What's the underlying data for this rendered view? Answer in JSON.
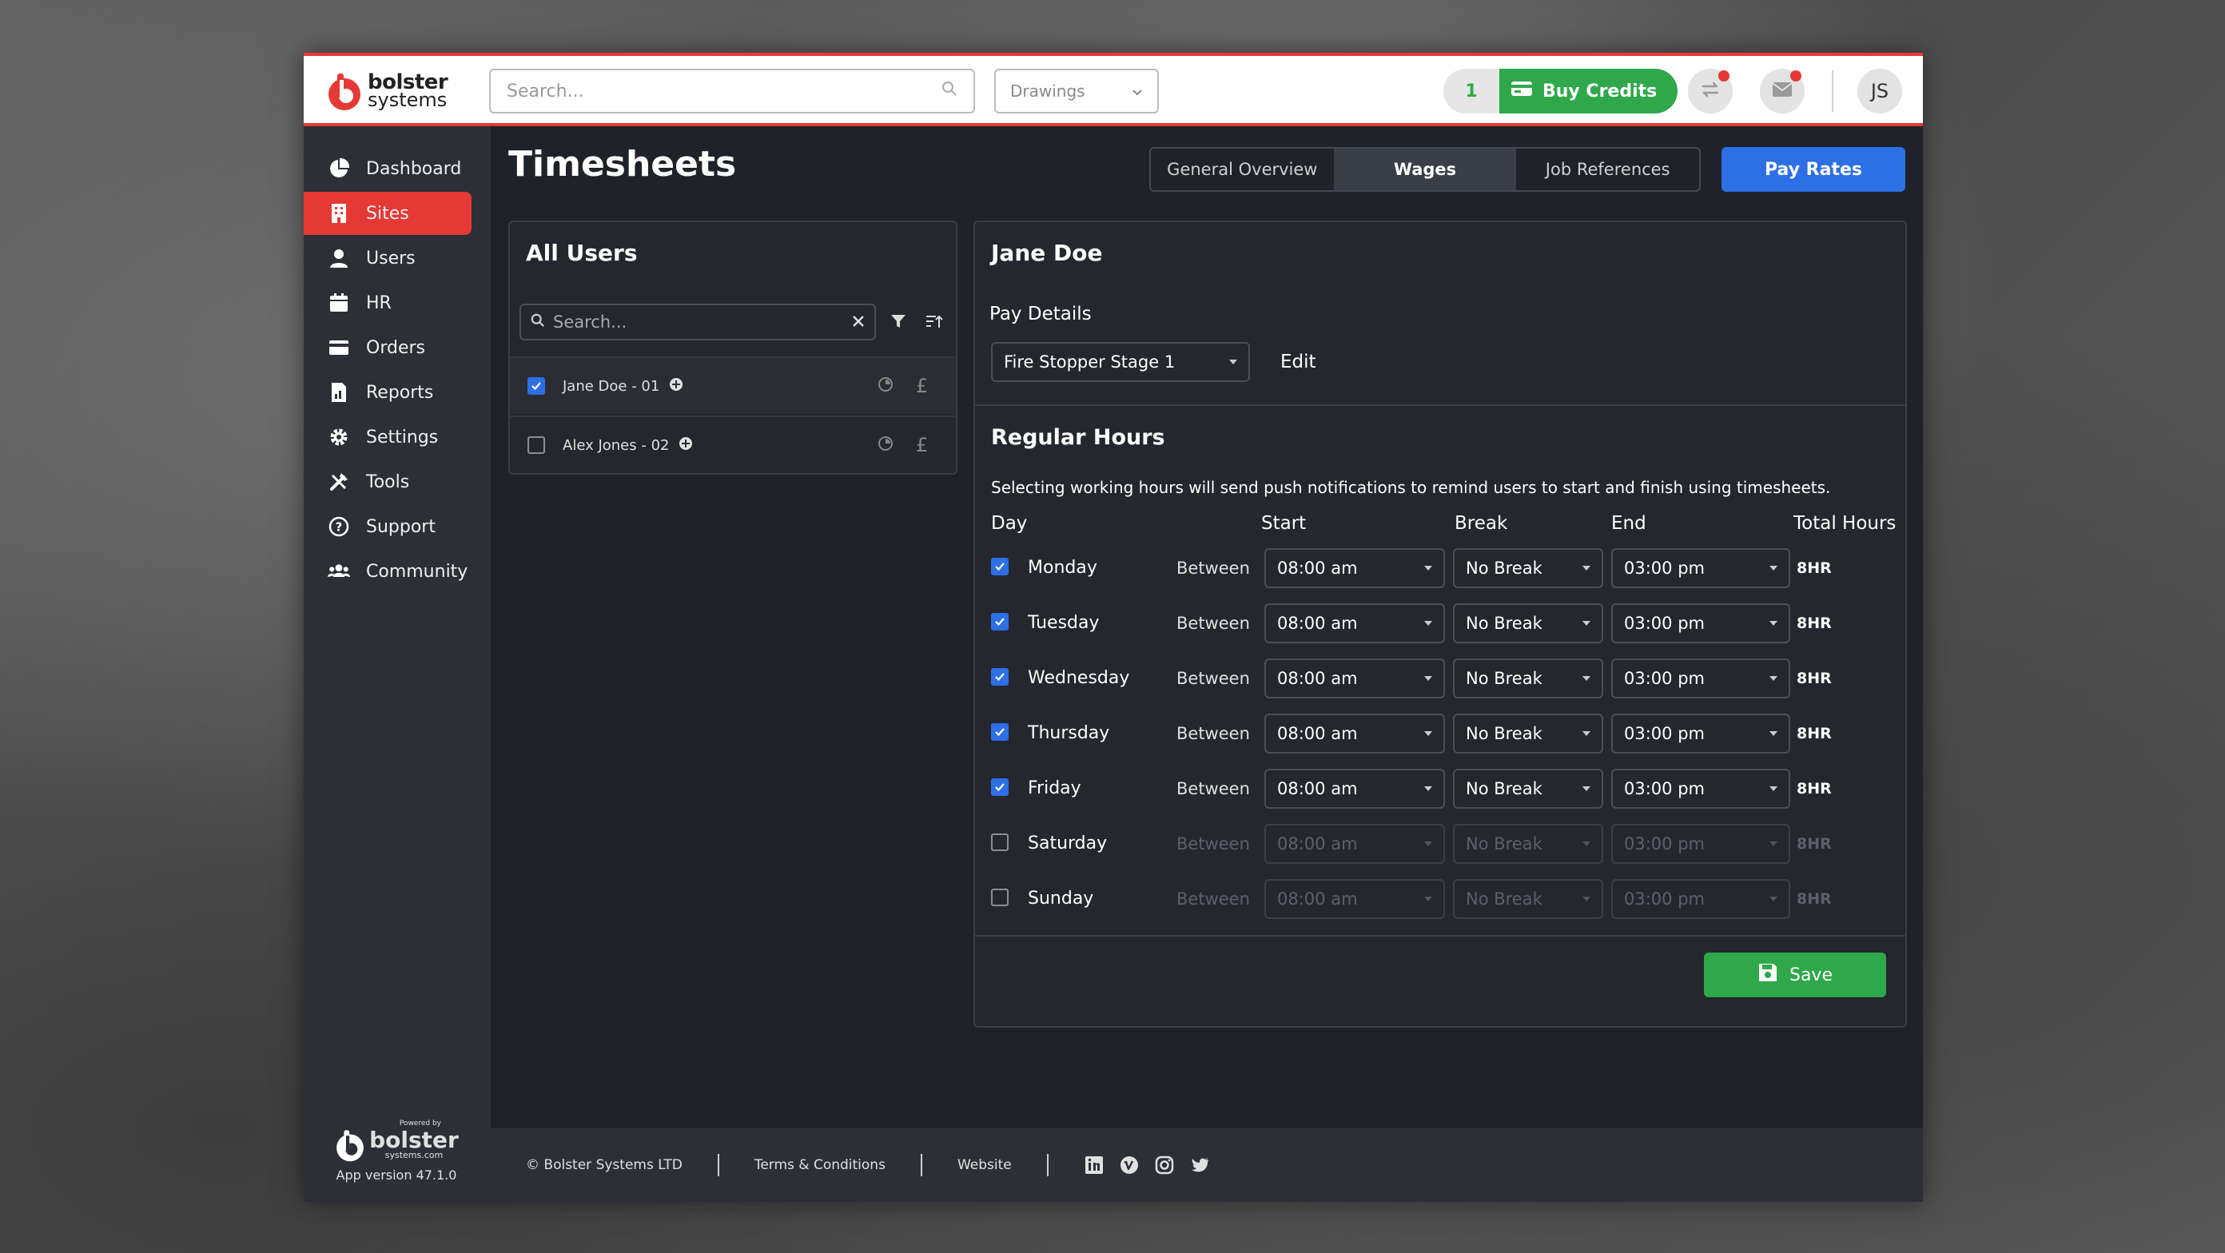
{
  "header": {
    "logo_line1": "bolster",
    "logo_line2": "systems",
    "search_placeholder": "Search...",
    "drawings_label": "Drawings",
    "credits_count": "1",
    "buy_credits_label": "Buy Credits",
    "avatar_initials": "JS"
  },
  "sidebar": {
    "items": [
      {
        "label": "Dashboard",
        "icon": "pie-chart-icon"
      },
      {
        "label": "Sites",
        "icon": "building-icon"
      },
      {
        "label": "Users",
        "icon": "user-icon"
      },
      {
        "label": "HR",
        "icon": "calendar-icon"
      },
      {
        "label": "Orders",
        "icon": "credit-card-icon"
      },
      {
        "label": "Reports",
        "icon": "report-icon"
      },
      {
        "label": "Settings",
        "icon": "gear-icon"
      },
      {
        "label": "Tools",
        "icon": "tools-icon"
      },
      {
        "label": "Support",
        "icon": "help-icon"
      },
      {
        "label": "Community",
        "icon": "community-icon"
      }
    ],
    "active_index": 1,
    "powered_by": "Powered by",
    "brand": "bolster",
    "brand_url": "systems.com",
    "app_version": "App version 47.1.0"
  },
  "main": {
    "title": "Timesheets",
    "tabs": [
      "General Overview",
      "Wages",
      "Job References"
    ],
    "active_tab": 1,
    "pay_rates_label": "Pay Rates"
  },
  "users_panel": {
    "title": "All Users",
    "search_placeholder": "Search...",
    "users": [
      {
        "name": "Jane Doe - 01",
        "checked": true
      },
      {
        "name": "Alex Jones - 02",
        "checked": false
      }
    ]
  },
  "detail": {
    "user_name": "Jane Doe",
    "pay_details_label": "Pay Details",
    "pay_rate_value": "Fire Stopper Stage 1",
    "edit_label": "Edit",
    "regular_hours_title": "Regular Hours",
    "notice": "Selecting working hours will send push notifications to remind users to start and finish using timesheets.",
    "columns": {
      "day": "Day",
      "start": "Start",
      "break": "Break",
      "end": "End",
      "total": "Total Hours"
    },
    "days": [
      {
        "name": "Monday",
        "checked": true,
        "between": "Between",
        "start": "08:00 am",
        "break": "No Break",
        "end": "03:00 pm",
        "total": "8HR"
      },
      {
        "name": "Tuesday",
        "checked": true,
        "between": "Between",
        "start": "08:00 am",
        "break": "No Break",
        "end": "03:00 pm",
        "total": "8HR"
      },
      {
        "name": "Wednesday",
        "checked": true,
        "between": "Between",
        "start": "08:00 am",
        "break": "No Break",
        "end": "03:00 pm",
        "total": "8HR"
      },
      {
        "name": "Thursday",
        "checked": true,
        "between": "Between",
        "start": "08:00 am",
        "break": "No Break",
        "end": "03:00 pm",
        "total": "8HR"
      },
      {
        "name": "Friday",
        "checked": true,
        "between": "Between",
        "start": "08:00 am",
        "break": "No Break",
        "end": "03:00 pm",
        "total": "8HR"
      },
      {
        "name": "Saturday",
        "checked": false,
        "between": "Between",
        "start": "08:00 am",
        "break": "No Break",
        "end": "03:00 pm",
        "total": "8HR"
      },
      {
        "name": "Sunday",
        "checked": false,
        "between": "Between",
        "start": "08:00 am",
        "break": "No Break",
        "end": "03:00 pm",
        "total": "8HR"
      }
    ],
    "save_label": "Save"
  },
  "footer": {
    "copyright": "© Bolster Systems LTD",
    "terms": "Terms & Conditions",
    "website": "Website",
    "social": [
      "linkedin-icon",
      "vimeo-icon",
      "instagram-icon",
      "twitter-icon"
    ]
  },
  "colors": {
    "accent_red": "#e53935",
    "accent_blue": "#2d6fe4",
    "accent_green": "#2ea84a",
    "background": "#1f2228"
  }
}
